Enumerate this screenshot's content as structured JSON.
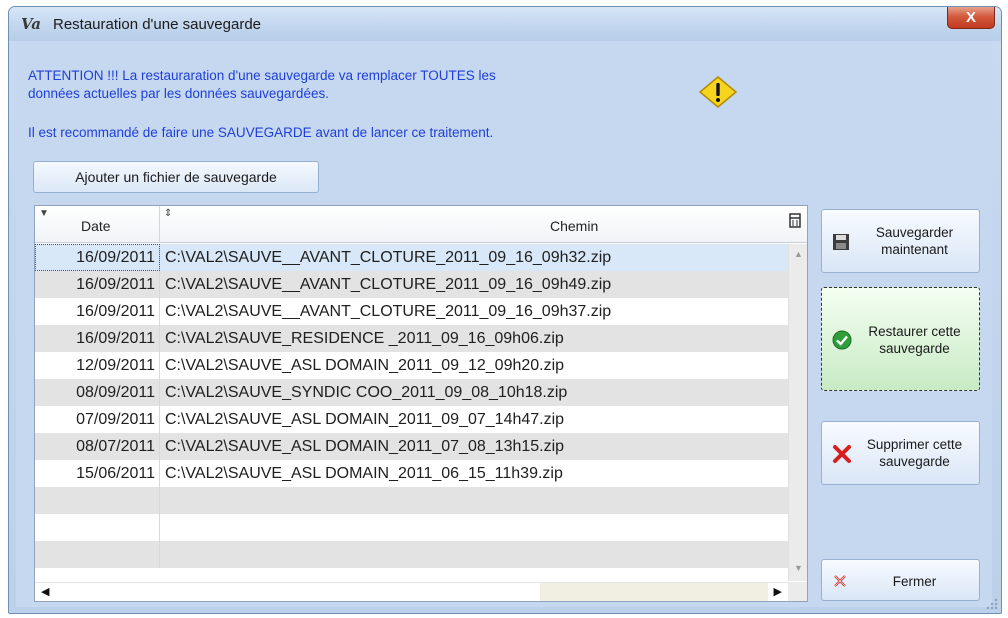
{
  "window": {
    "title": "Restauration d'une sauvegarde",
    "app_icon_glyph": "Va",
    "close_glyph": "X"
  },
  "warning": {
    "line1": "ATTENTION !!! La restauraration d'une sauvegarde va remplacer TOUTES les",
    "line2": "données actuelles par les données sauvegardées.",
    "line3": "Il est recommandé de faire une SAUVEGARDE avant de lancer ce traitement.",
    "icon": "warning-diamond-icon"
  },
  "add_button_label": "Ajouter un fichier de sauvegarde",
  "table": {
    "columns": [
      "Date",
      "Chemin"
    ],
    "rows": [
      {
        "date": "16/09/2011",
        "path": "C:\\VAL2\\SAUVE__AVANT_CLOTURE_2011_09_16_09h32.zip"
      },
      {
        "date": "16/09/2011",
        "path": "C:\\VAL2\\SAUVE__AVANT_CLOTURE_2011_09_16_09h49.zip"
      },
      {
        "date": "16/09/2011",
        "path": "C:\\VAL2\\SAUVE__AVANT_CLOTURE_2011_09_16_09h37.zip"
      },
      {
        "date": "16/09/2011",
        "path": "C:\\VAL2\\SAUVE_RESIDENCE _2011_09_16_09h06.zip"
      },
      {
        "date": "12/09/2011",
        "path": "C:\\VAL2\\SAUVE_ASL DOMAIN_2011_09_12_09h20.zip"
      },
      {
        "date": "08/09/2011",
        "path": "C:\\VAL2\\SAUVE_SYNDIC COO_2011_09_08_10h18.zip"
      },
      {
        "date": "07/09/2011",
        "path": "C:\\VAL2\\SAUVE_ASL DOMAIN_2011_09_07_14h47.zip"
      },
      {
        "date": "08/07/2011",
        "path": "C:\\VAL2\\SAUVE_ASL DOMAIN_2011_07_08_13h15.zip"
      },
      {
        "date": "15/06/2011",
        "path": "C:\\VAL2\\SAUVE_ASL DOMAIN_2011_06_15_11h39.zip"
      },
      {
        "date": "",
        "path": ""
      },
      {
        "date": "",
        "path": ""
      },
      {
        "date": "",
        "path": ""
      }
    ],
    "selected_index": 0
  },
  "buttons": {
    "save_now": {
      "line1": "Sauvegarder",
      "line2": "maintenant",
      "icon": "floppy-disk-icon"
    },
    "restore": {
      "line1": "Restaurer cette",
      "line2": "sauvegarde",
      "icon": "green-check-icon"
    },
    "delete": {
      "line1": "Supprimer cette",
      "line2": "sauvegarde",
      "icon": "red-x-icon"
    },
    "close": {
      "label": "Fermer",
      "icon": "close-x-icon"
    }
  },
  "colors": {
    "warning_text": "#1f3fd8",
    "window_bg": "#c5d8ef",
    "row_alt": "#e3e3e3",
    "row_selected": "#d8e8f8",
    "restore_active": "#c8eac4"
  }
}
